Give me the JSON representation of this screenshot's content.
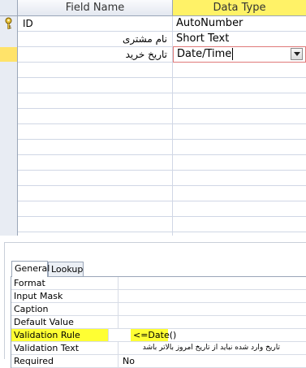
{
  "grid": {
    "header_field_name": "Field Name",
    "header_data_type": "Data Type",
    "rows": [
      {
        "field_name": "ID",
        "data_type": "AutoNumber"
      },
      {
        "field_name": "نام مشتری",
        "data_type": "Short Text"
      },
      {
        "field_name": "تاریخ خرید",
        "data_type": "Date/Time"
      }
    ]
  },
  "properties": {
    "tabs": [
      "General",
      "Lookup"
    ],
    "rows": [
      {
        "label": "Format",
        "value": ""
      },
      {
        "label": "Input Mask",
        "value": ""
      },
      {
        "label": "Caption",
        "value": ""
      },
      {
        "label": "Default Value",
        "value": ""
      },
      {
        "label": "Validation Rule",
        "value": "<=Date()"
      },
      {
        "label": "Validation Text",
        "value": "تاریخ وارد شده نباید از تاریخ امروز بالاتر باشد"
      },
      {
        "label": "Required",
        "value": "No"
      }
    ]
  },
  "colors": {
    "highlight": "#ffff33",
    "header_selected": "#fff267",
    "current_row_selector": "#ffe36a"
  },
  "icons": {
    "primary_key": "key-icon",
    "dropdown": "chevron-down-icon"
  }
}
